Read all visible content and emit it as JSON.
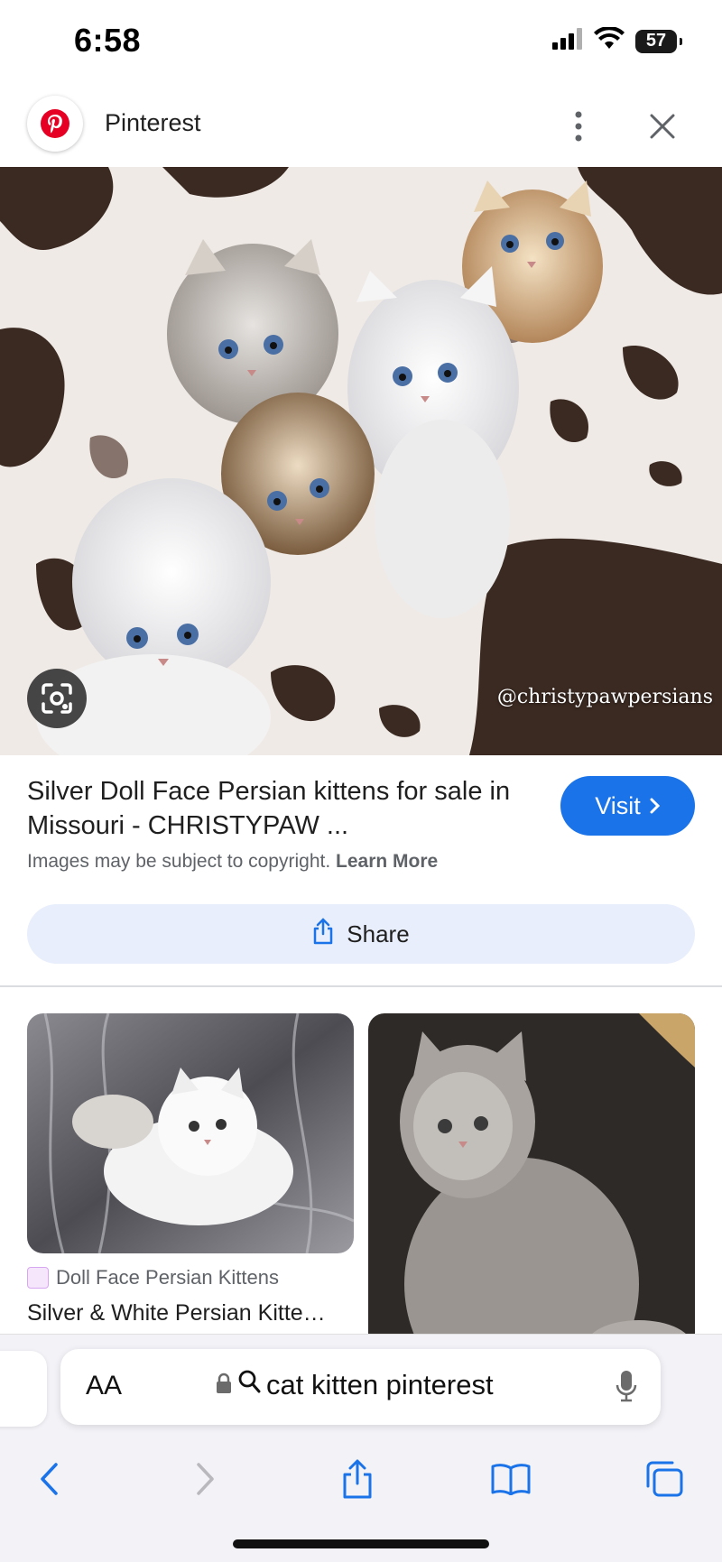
{
  "status": {
    "time": "6:58",
    "battery": "57"
  },
  "header": {
    "title": "Pinterest"
  },
  "hero": {
    "watermark": "@christypawpersians"
  },
  "result": {
    "title": "Silver Doll Face Persian kittens for sale in Missouri - CHRISTYPAW ...",
    "visit_label": "Visit",
    "copyright_text": "Images may be subject to copyright.",
    "learn_more": "Learn More",
    "share_label": "Share"
  },
  "related": [
    {
      "source": "Doll Face Persian Kittens",
      "title": "Silver & White Persian Kitte…"
    },
    {
      "source": "",
      "title": ""
    }
  ],
  "browser": {
    "text_size_label": "AA",
    "url": "cat kitten pinterest"
  },
  "colors": {
    "accent": "#1a73e8",
    "share_bg": "#e8eefb",
    "pinterest_red": "#e60023"
  },
  "icons": [
    "pinterest-logo-icon",
    "more-vert-icon",
    "close-icon",
    "google-lens-icon",
    "chevron-right-icon",
    "share-icon",
    "lock-icon",
    "search-icon",
    "mic-icon",
    "back-icon",
    "forward-icon",
    "safari-share-icon",
    "bookmarks-icon",
    "tabs-icon"
  ]
}
